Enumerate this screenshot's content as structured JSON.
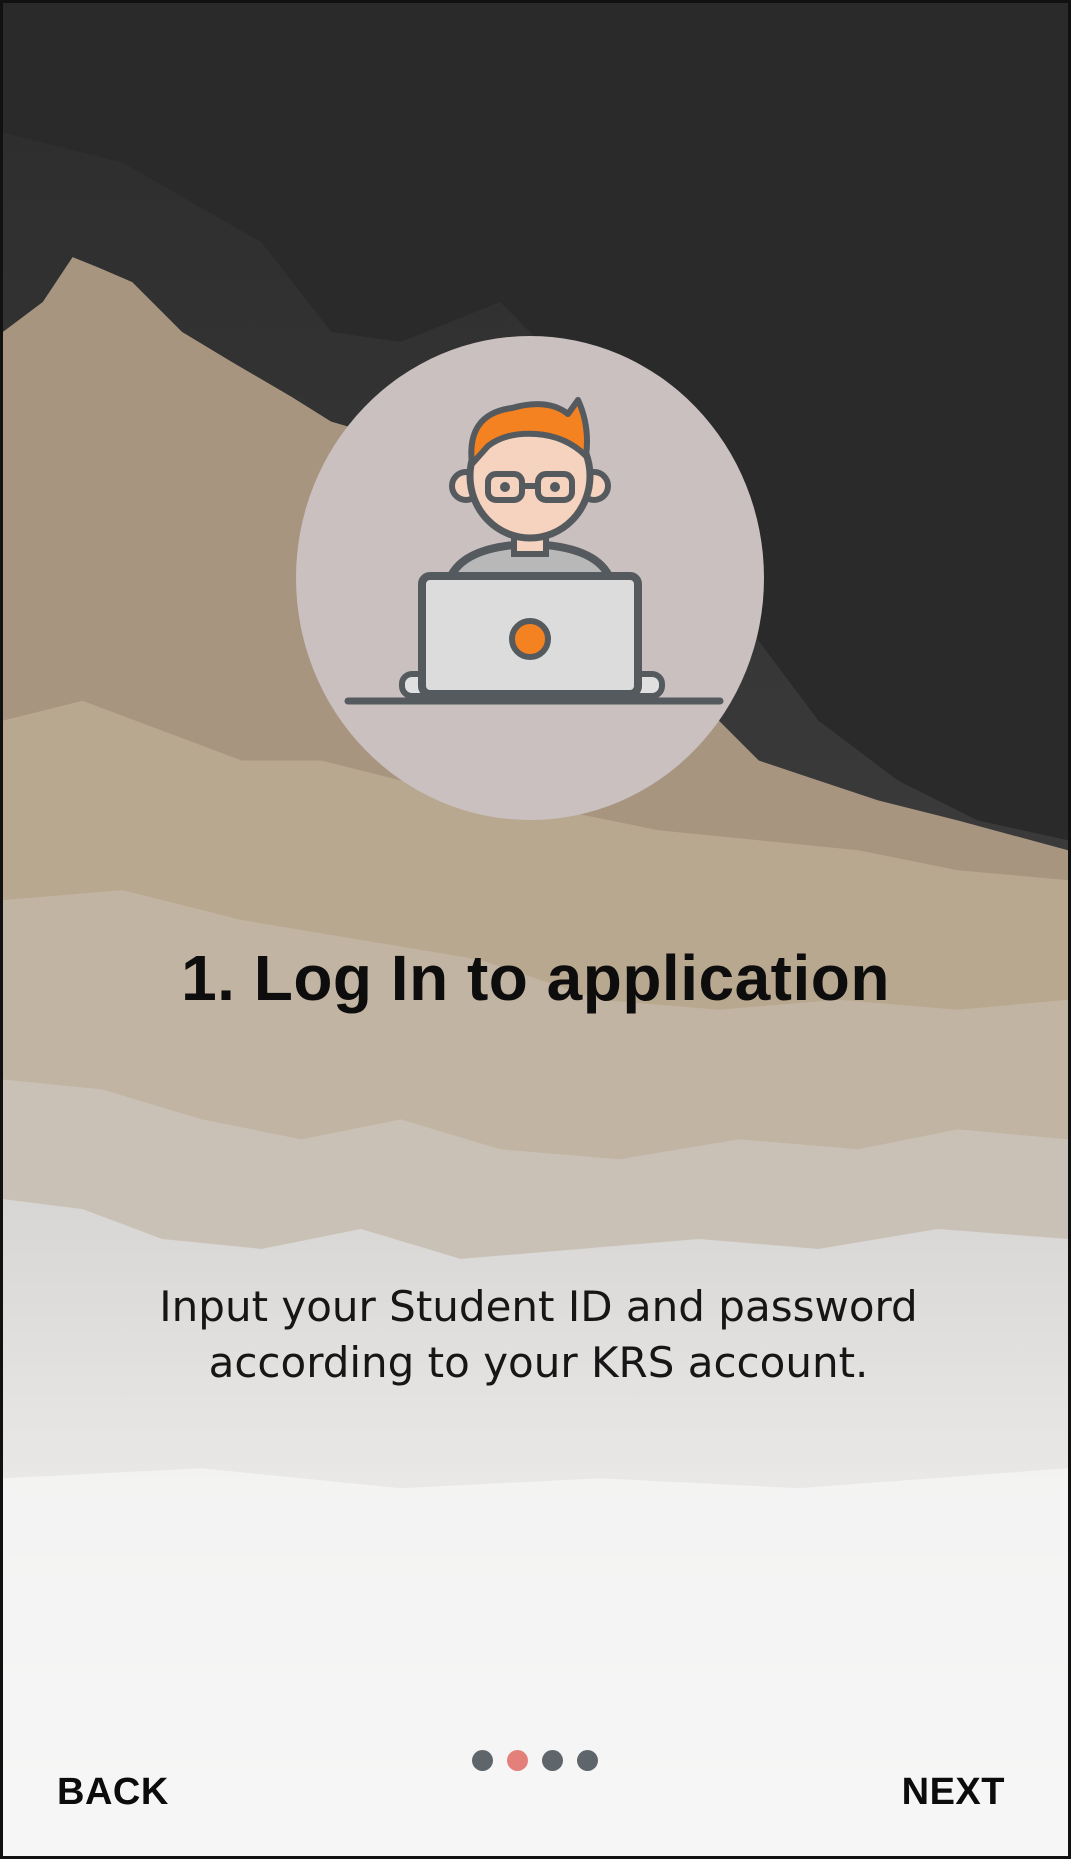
{
  "onboarding": {
    "title": "1. Log In to application",
    "description_lines": [
      "Input your Student ID and password",
      "according to your KRS account."
    ],
    "back_label": "BACK",
    "next_label": "NEXT",
    "pager": {
      "total": 4,
      "active_index": 1
    },
    "illustration_icon": "person-with-laptop-icon"
  },
  "colors": {
    "accent_orange": "#f58220",
    "active_dot": "#e4807a",
    "inactive_dot": "#5f666b",
    "circle_bg": "#c9c0bf"
  }
}
